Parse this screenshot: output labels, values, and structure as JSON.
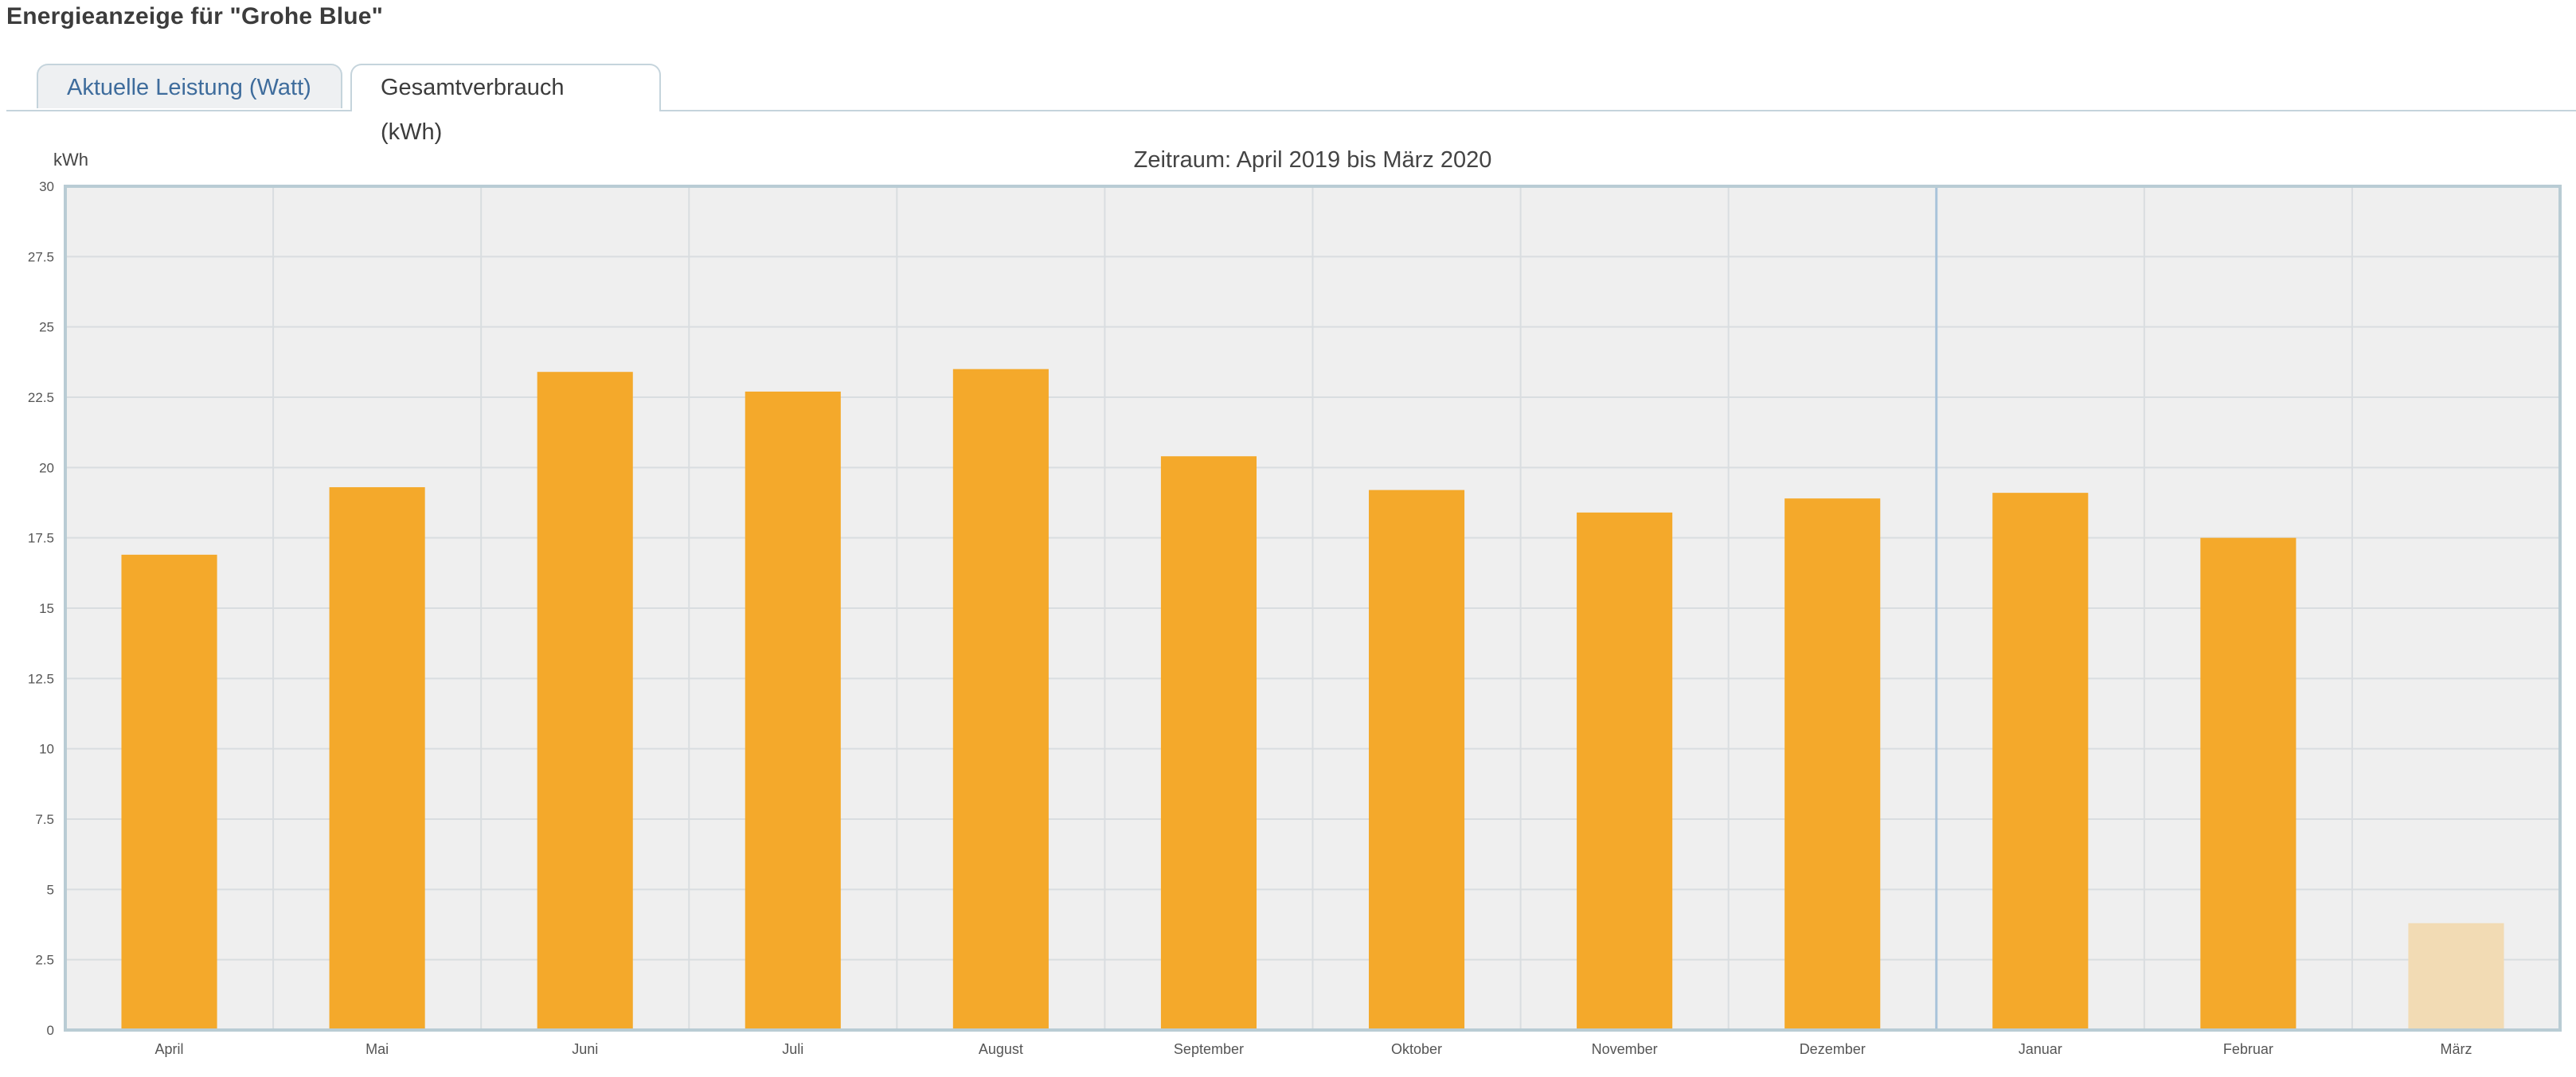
{
  "page": {
    "title": "Energieanzeige für \"Grohe Blue\""
  },
  "tabs": [
    {
      "label": "Aktuelle Leistung (Watt)",
      "active": false
    },
    {
      "label": "Gesamtverbrauch (kWh)",
      "active": true
    }
  ],
  "chart_data": {
    "type": "bar",
    "title": "Zeitraum: April 2019 bis März 2020",
    "ylabel": "kWh",
    "xlabel": "",
    "ylim": [
      0,
      30
    ],
    "yticks": [
      "0",
      "2.5",
      "5",
      "7.5",
      "10",
      "12.5",
      "15",
      "17.5",
      "20",
      "22.5",
      "25",
      "27.5",
      "30"
    ],
    "categories": [
      "April",
      "Mai",
      "Juni",
      "Juli",
      "August",
      "September",
      "Oktober",
      "November",
      "Dezember",
      "Januar",
      "Februar",
      "März"
    ],
    "values": [
      16.9,
      19.3,
      23.4,
      22.7,
      23.5,
      20.4,
      19.2,
      18.4,
      18.9,
      19.1,
      17.5,
      3.8
    ],
    "grid": true,
    "colors": {
      "bar": "#f4a92b",
      "bar_partial": "#f2dbb4",
      "plot_background": "#efefef",
      "grid": "#d9dde0",
      "year_separator": "#a9c3da"
    },
    "partial_last_period": true,
    "year_separator_before": "Januar"
  }
}
